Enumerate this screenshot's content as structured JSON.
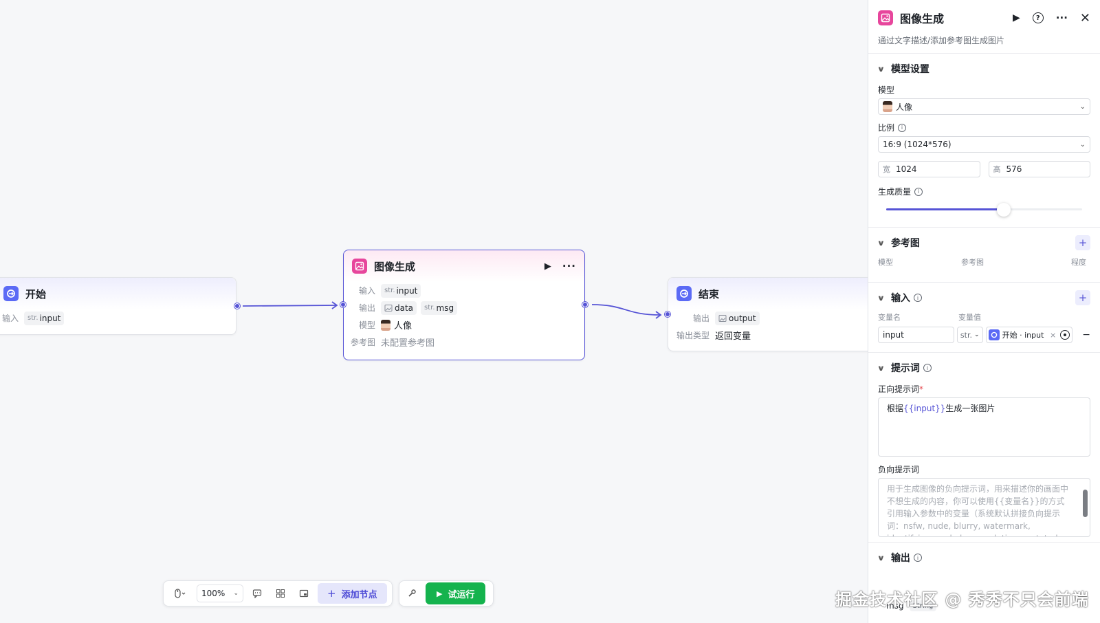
{
  "canvas": {
    "start_node": {
      "title": "开始",
      "input_label": "输入",
      "input_type": "str.",
      "input_name": "input"
    },
    "image_node": {
      "title": "图像生成",
      "input_label": "输入",
      "input_type": "str.",
      "input_name": "input",
      "output_label": "输出",
      "output_1": "data",
      "output_2_type": "str.",
      "output_2": "msg",
      "model_label": "模型",
      "model_value": "人像",
      "ref_label": "参考图",
      "ref_value": "未配置参考图"
    },
    "end_node": {
      "title": "结束",
      "output_label": "输出",
      "output_name": "output",
      "type_label": "输出类型",
      "type_value": "返回变量"
    }
  },
  "toolbar": {
    "zoom": "100%",
    "add_node": "添加节点",
    "run": "试运行"
  },
  "panel": {
    "title": "图像生成",
    "description": "通过文字描述/添加参考图生成图片",
    "model_section": {
      "title": "模型设置",
      "model_label": "模型",
      "model_value": "人像",
      "ratio_label": "比例",
      "ratio_value": "16:9 (1024*576)",
      "width_prefix": "宽",
      "width_value": "1024",
      "height_prefix": "高",
      "height_value": "576",
      "quality_label": "生成质量",
      "quality_level": 0.6
    },
    "ref_section": {
      "title": "参考图",
      "col1": "模型",
      "col2": "参考图",
      "col3": "程度"
    },
    "input_section": {
      "title": "输入",
      "col_name": "变量名",
      "col_value": "变量值",
      "var_name": "input",
      "var_type": "str.",
      "ref_value": "开始 · input"
    },
    "prompt_section": {
      "title": "提示词",
      "positive_label": "正向提示词",
      "positive_pre": "根据",
      "positive_var": "{{input}}",
      "positive_post": "生成一张图片",
      "negative_label": "负向提示词",
      "negative_placeholder": "用于生成图像的负向提示词，用来描述你的画面中不想生成的内容，你可以使用{{变量名}}的方式引用输入参数中的变量（系统默认拼接负向提示词：nsfw, nude, blurry, watermark, identifying mark, low resolution, mutated, lack of hierarchy）"
    },
    "output_section": {
      "title": "输出",
      "var": "msg",
      "var_type": "String"
    }
  },
  "watermark": "掘金技术社区 @ 秀秀不只会前端",
  "colors": {
    "accent": "#5654d6",
    "run_green": "#15b34e",
    "pink_icon": "#e7469c",
    "blue_icon": "#5b6af5"
  }
}
